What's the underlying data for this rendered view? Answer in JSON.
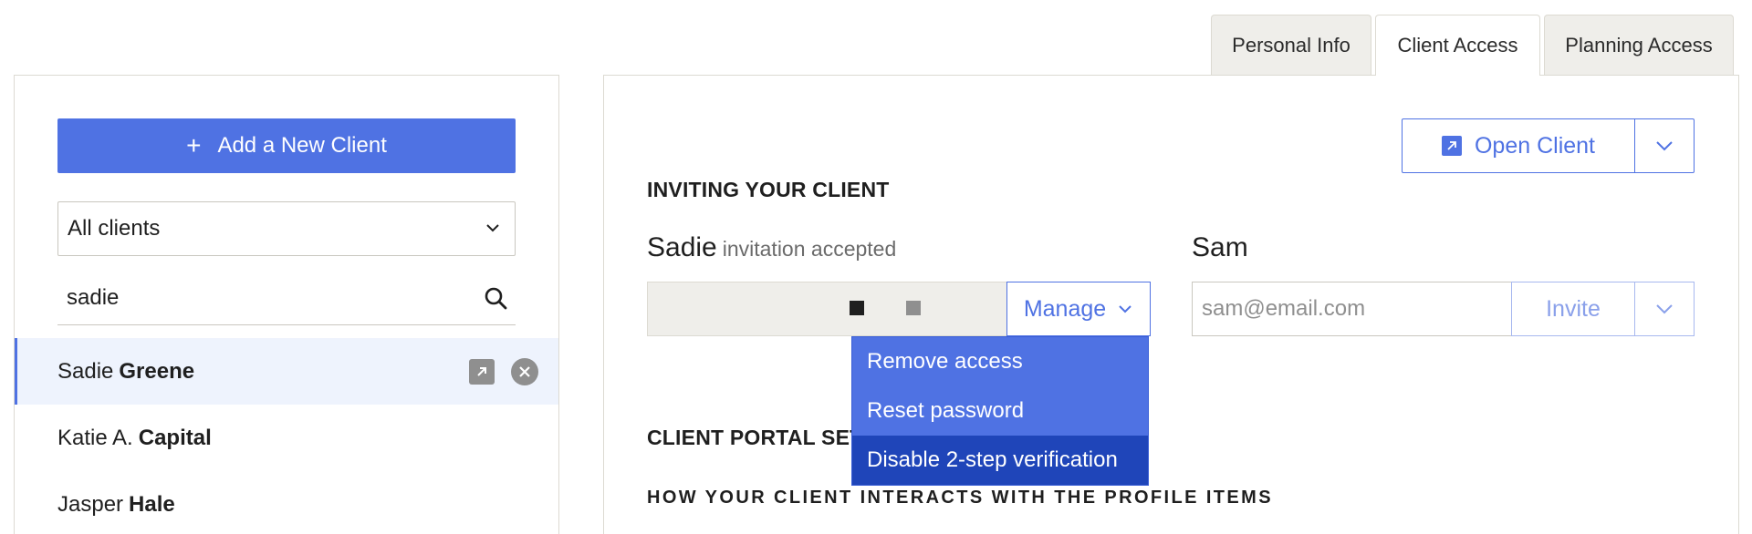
{
  "tabs": {
    "personal_info": "Personal Info",
    "client_access": "Client Access",
    "planning_access": "Planning Access",
    "active": "Client Access"
  },
  "sidebar": {
    "add_button_label": "Add a New Client",
    "filter_value": "All clients",
    "search_value": "sadie",
    "clients": [
      {
        "first": "Sadie",
        "last": "Greene",
        "active": true
      },
      {
        "first": "Katie A.",
        "last": "Capital",
        "active": false
      },
      {
        "first": "Jasper",
        "last": "Hale",
        "active": false
      }
    ]
  },
  "main": {
    "open_client_label": "Open Client",
    "inviting_title": "INVITING YOUR CLIENT",
    "sadie": {
      "name": "Sadie",
      "status": "invitation accepted",
      "manage_label": "Manage"
    },
    "sam": {
      "name": "Sam",
      "email_placeholder": "sam@email.com",
      "invite_label": "Invite"
    },
    "manage_menu": [
      "Remove access",
      "Reset password",
      "Disable 2-step verification"
    ],
    "portal_title": "CLIENT PORTAL SET",
    "interaction_title": "HOW YOUR CLIENT INTERACTS WITH THE PROFILE ITEMS"
  },
  "colors": {
    "accent": "#4f72e3",
    "accent_dark": "#1f45b9",
    "active_row": "#eef3fd",
    "tab_inactive": "#efeeea",
    "icon_gray": "#8f8f8f"
  }
}
